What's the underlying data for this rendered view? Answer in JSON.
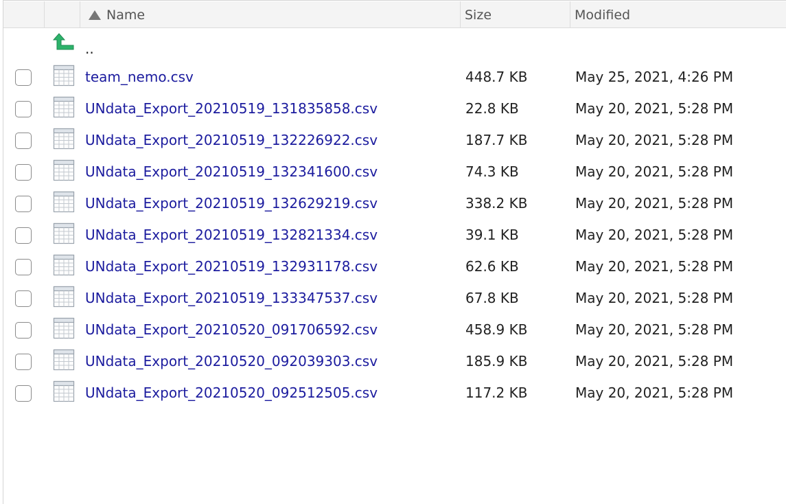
{
  "header": {
    "name_label": "Name",
    "size_label": "Size",
    "modified_label": "Modified",
    "sort_icon": "sort-ascending-icon"
  },
  "parent_dir": {
    "label": "..",
    "icon": "up-arrow-icon",
    "icon_color": "#2db36b"
  },
  "files": [
    {
      "name": "team_nemo.csv",
      "size": "448.7 KB",
      "modified": "May 25, 2021, 4:26 PM"
    },
    {
      "name": "UNdata_Export_20210519_131835858.csv",
      "size": "22.8 KB",
      "modified": "May 20, 2021, 5:28 PM"
    },
    {
      "name": "UNdata_Export_20210519_132226922.csv",
      "size": "187.7 KB",
      "modified": "May 20, 2021, 5:28 PM"
    },
    {
      "name": "UNdata_Export_20210519_132341600.csv",
      "size": "74.3 KB",
      "modified": "May 20, 2021, 5:28 PM"
    },
    {
      "name": "UNdata_Export_20210519_132629219.csv",
      "size": "338.2 KB",
      "modified": "May 20, 2021, 5:28 PM"
    },
    {
      "name": "UNdata_Export_20210519_132821334.csv",
      "size": "39.1 KB",
      "modified": "May 20, 2021, 5:28 PM"
    },
    {
      "name": "UNdata_Export_20210519_132931178.csv",
      "size": "62.6 KB",
      "modified": "May 20, 2021, 5:28 PM"
    },
    {
      "name": "UNdata_Export_20210519_133347537.csv",
      "size": "67.8 KB",
      "modified": "May 20, 2021, 5:28 PM"
    },
    {
      "name": "UNdata_Export_20210520_091706592.csv",
      "size": "458.9 KB",
      "modified": "May 20, 2021, 5:28 PM"
    },
    {
      "name": "UNdata_Export_20210520_092039303.csv",
      "size": "185.9 KB",
      "modified": "May 20, 2021, 5:28 PM"
    },
    {
      "name": "UNdata_Export_20210520_092512505.csv",
      "size": "117.2 KB",
      "modified": "May 20, 2021, 5:28 PM"
    }
  ],
  "colors": {
    "link": "#1b1b9e",
    "header_bg": "#f4f4f4"
  }
}
